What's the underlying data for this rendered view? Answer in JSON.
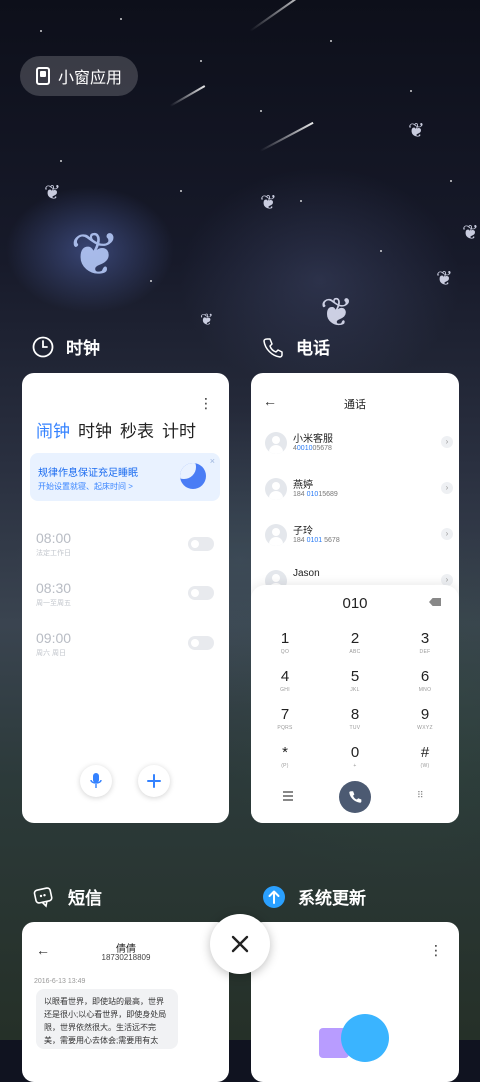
{
  "floating_window": {
    "label": "小窗应用"
  },
  "clock": {
    "app_name": "时钟",
    "more_icon": "more-vertical-icon",
    "tabs": [
      "闹钟",
      "时钟",
      "秒表",
      "计时"
    ],
    "active_tab": "闹钟",
    "banner": {
      "title": "规律作息保证充足睡眠",
      "subtitle": "开始设置就寝、起床时间 >",
      "close": "×"
    },
    "alarms": [
      {
        "time": "08:00",
        "repeat": "法定工作日",
        "enabled": false
      },
      {
        "time": "08:30",
        "repeat": "周一至周五",
        "enabled": false
      },
      {
        "time": "09:00",
        "repeat": "周六 周日",
        "enabled": false
      }
    ],
    "mic_icon": "microphone-icon",
    "add_icon": "plus-icon"
  },
  "phone": {
    "app_name": "电话",
    "back": "←",
    "title": "通话",
    "contacts": [
      {
        "name": "小米客服",
        "num_pre": "4",
        "num_hl": "0010",
        "num_post": "05678"
      },
      {
        "name": "燕婷",
        "num_pre": "184 ",
        "num_hl": "010",
        "num_post": "15689"
      },
      {
        "name": "子玲",
        "num_pre": "184 ",
        "num_hl": "0101",
        "num_post": " 5678"
      },
      {
        "name": "Jason",
        "num_pre": "",
        "num_hl": "",
        "num_post": ""
      }
    ],
    "dialed_number": "010",
    "keys": [
      {
        "digit": "1",
        "letters": "QO"
      },
      {
        "digit": "2",
        "letters": "ABC"
      },
      {
        "digit": "3",
        "letters": "DEF"
      },
      {
        "digit": "4",
        "letters": "GHI"
      },
      {
        "digit": "5",
        "letters": "JKL"
      },
      {
        "digit": "6",
        "letters": "MNO"
      },
      {
        "digit": "7",
        "letters": "PQRS"
      },
      {
        "digit": "8",
        "letters": "TUV"
      },
      {
        "digit": "9",
        "letters": "WXYZ"
      },
      {
        "digit": "*",
        "letters": "(P)"
      },
      {
        "digit": "0",
        "letters": "+"
      },
      {
        "digit": "#",
        "letters": "(W)"
      }
    ],
    "grid_icon": "⠿"
  },
  "sms": {
    "app_name": "短信",
    "back": "←",
    "contact_name": "倩倩",
    "contact_number": "18730218809",
    "timestamp": "2016-6-13 13:49",
    "message": "以眼看世界，即使站的最高，世界还是很小;以心看世界，即使身处局限，世界依然很大。生活远不完美，需要用心去体会;需要用有太多，需"
  },
  "update": {
    "app_name": "系统更新",
    "more_icon": "more-vertical-icon"
  },
  "close_all": {
    "icon": "close-icon"
  },
  "colors": {
    "accent": "#3482ff",
    "call_button": "#4c5a72",
    "update_icon": "#2aa0ff"
  }
}
